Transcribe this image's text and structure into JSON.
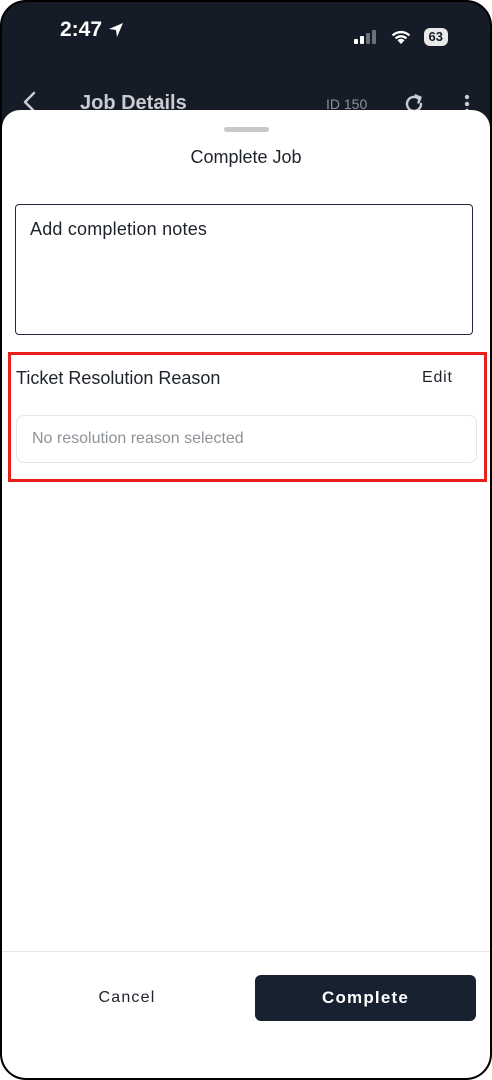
{
  "status_bar": {
    "time": "2:47",
    "battery": "63"
  },
  "header": {
    "title": "Job Details",
    "id_label": "ID 150"
  },
  "sheet": {
    "title": "Complete Job",
    "notes_placeholder": "Add completion notes",
    "resolution": {
      "label": "Ticket Resolution Reason",
      "edit_label": "Edit",
      "value": "No resolution reason selected"
    },
    "actions": {
      "cancel_label": "Cancel",
      "complete_label": "Complete"
    }
  },
  "colors": {
    "primary": "#18212f",
    "highlight": "#e8201b"
  }
}
